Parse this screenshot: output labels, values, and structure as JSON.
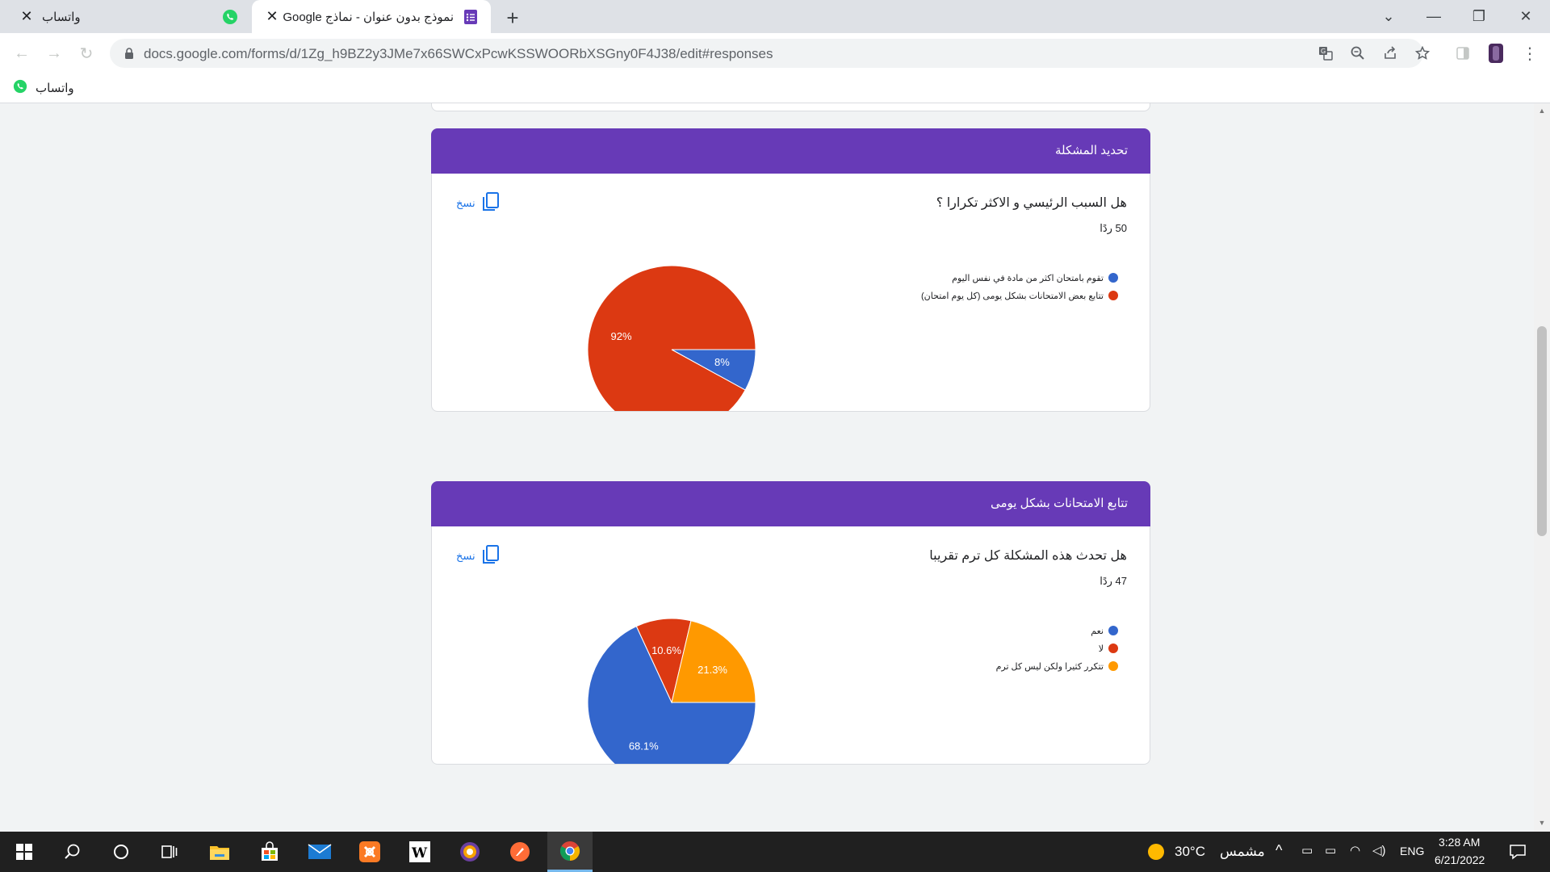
{
  "tabs": [
    {
      "title": "واتساب",
      "active": false
    },
    {
      "title": "نموذج بدون عنوان - نماذج Google",
      "active": true
    }
  ],
  "address": {
    "url": "docs.google.com/forms/d/1Zg_h9BZ2y3JMe7x66SWCxPcwKSSWOORbXSGny0F4J38/edit#responses"
  },
  "bookmarks": [
    {
      "label": "واتساب"
    }
  ],
  "sections": [
    {
      "header": "تحديد المشكلة",
      "question": "هل السبب الرئيسي و الاكثر تكرارا ؟",
      "response_count": "50 ردًا",
      "copy_label": "نسخ",
      "chart_data": {
        "type": "pie",
        "slices": [
          {
            "label": "تقوم بامتحان اكثر من مادة في نفس اليوم",
            "value": 8,
            "display": "8%",
            "color": "#3366cc"
          },
          {
            "label": "تتابع بعض الامتحانات بشكل يومى (كل يوم امتحان)",
            "value": 92,
            "display": "92%",
            "color": "#dc3912"
          }
        ]
      }
    },
    {
      "header": "تتابع الامتحانات بشكل يومى",
      "question": "هل تحدث هذه المشكلة كل ترم تقريبا",
      "response_count": "47 ردًا",
      "copy_label": "نسخ",
      "chart_data": {
        "type": "pie",
        "slices": [
          {
            "label": "نعم",
            "value": 68.1,
            "display": "68.1%",
            "color": "#3366cc"
          },
          {
            "label": "لا",
            "value": 10.6,
            "display": "10.6%",
            "color": "#dc3912"
          },
          {
            "label": "تتكرر كثيرا ولكن ليس كل ترم",
            "value": 21.3,
            "display": "21.3%",
            "color": "#ff9900"
          }
        ]
      }
    }
  ],
  "taskbar": {
    "weather_temp": "30°C",
    "weather_text": "مشمس",
    "language": "ENG",
    "time": "3:28 AM",
    "date": "6/21/2022"
  }
}
